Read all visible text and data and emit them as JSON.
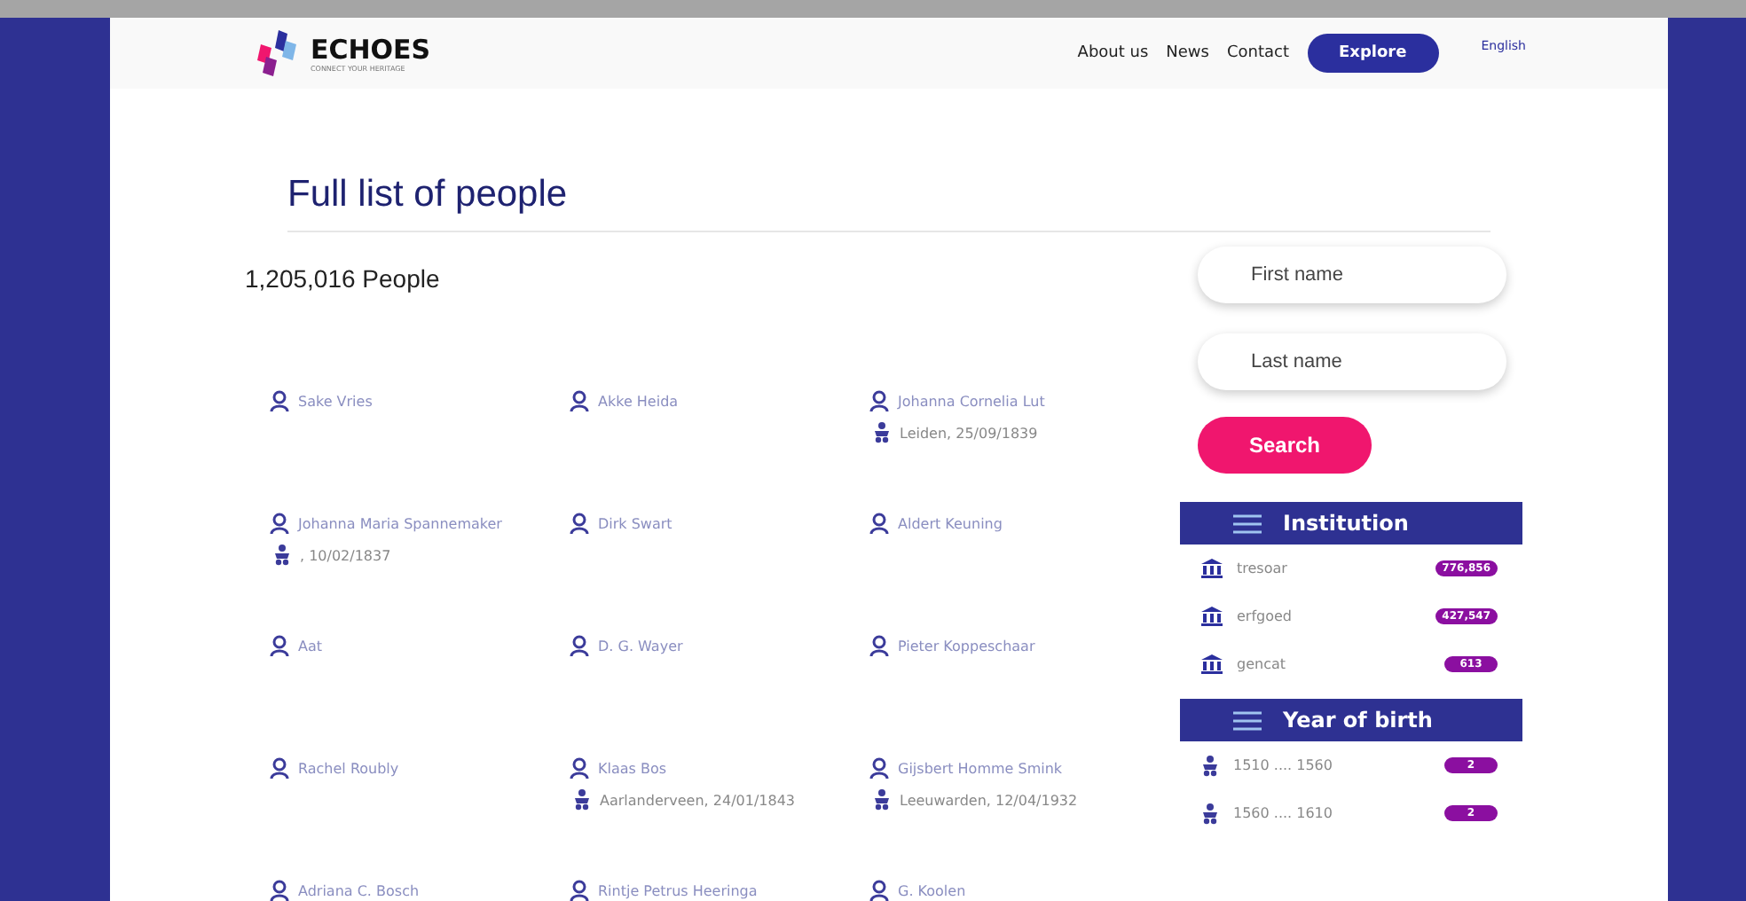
{
  "header": {
    "logo": {
      "name": "ECHOES",
      "tagline": "CONNECT YOUR HERITAGE"
    },
    "nav": [
      {
        "label": "About us",
        "kind": "link"
      },
      {
        "label": "News",
        "kind": "link"
      },
      {
        "label": "Contact",
        "kind": "link"
      },
      {
        "label": "Explore",
        "kind": "button"
      }
    ],
    "language": "English"
  },
  "title": "Full list of people",
  "count": "1,205,016 People",
  "people": [
    {
      "name": "Sake Vries"
    },
    {
      "name": "Akke Heida"
    },
    {
      "name": "Johanna Cornelia Lut",
      "birth": "Leiden, 25/09/1839"
    },
    {
      "name": "Johanna Maria Spannemaker",
      "birth": ", 10/02/1837"
    },
    {
      "name": "Dirk Swart"
    },
    {
      "name": "Aldert Keuning"
    },
    {
      "name": "Aat"
    },
    {
      "name": "D. G. Wayer"
    },
    {
      "name": "Pieter Koppeschaar"
    },
    {
      "name": "Rachel Roubly"
    },
    {
      "name": "Klaas Bos",
      "birth": "Aarlanderveen, 24/01/1843"
    },
    {
      "name": "Gijsbert Homme Smink",
      "birth": "Leeuwarden, 12/04/1932"
    },
    {
      "name": "Adriana C. Bosch"
    },
    {
      "name": "Rintje Petrus Heeringa"
    },
    {
      "name": "G. Koolen"
    }
  ],
  "search": {
    "fields": [
      {
        "placeholder": "First name"
      },
      {
        "placeholder": "Last name"
      }
    ],
    "button": "Search"
  },
  "facets": [
    {
      "title": "Institution",
      "kind": "institution",
      "items": [
        {
          "label": "tresoar",
          "count": "776,856"
        },
        {
          "label": "erfgoed",
          "count": "427,547"
        },
        {
          "label": "gencat",
          "count": "613"
        }
      ]
    },
    {
      "title": "Year of birth",
      "kind": "birth",
      "items": [
        {
          "label": "1510 .... 1560",
          "count": "2"
        },
        {
          "label": "1560 .... 1610",
          "count": "2"
        }
      ]
    }
  ]
}
